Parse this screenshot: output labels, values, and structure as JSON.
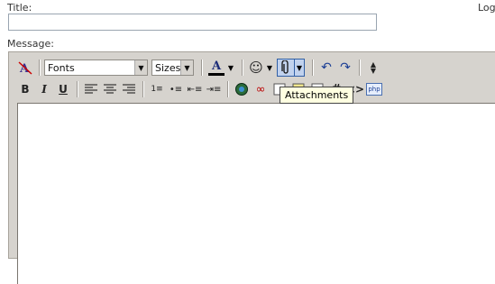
{
  "header": {
    "title_label": "Title:",
    "log_label": "Log",
    "message_label": "Message:"
  },
  "title_field": {
    "value": ""
  },
  "toolbar": {
    "fonts_label": "Fonts",
    "sizes_label": "Sizes",
    "text_color_letter": "A",
    "bold": "B",
    "italic": "I",
    "underline": "U",
    "hash": "#",
    "code": "<>",
    "php": "php"
  },
  "tooltip": {
    "text": "Attachments"
  },
  "colors": {
    "toolbar_bg": "#d6d3ce",
    "highlight": "#c1d2ee",
    "tooltip_bg": "#ffffe1"
  }
}
